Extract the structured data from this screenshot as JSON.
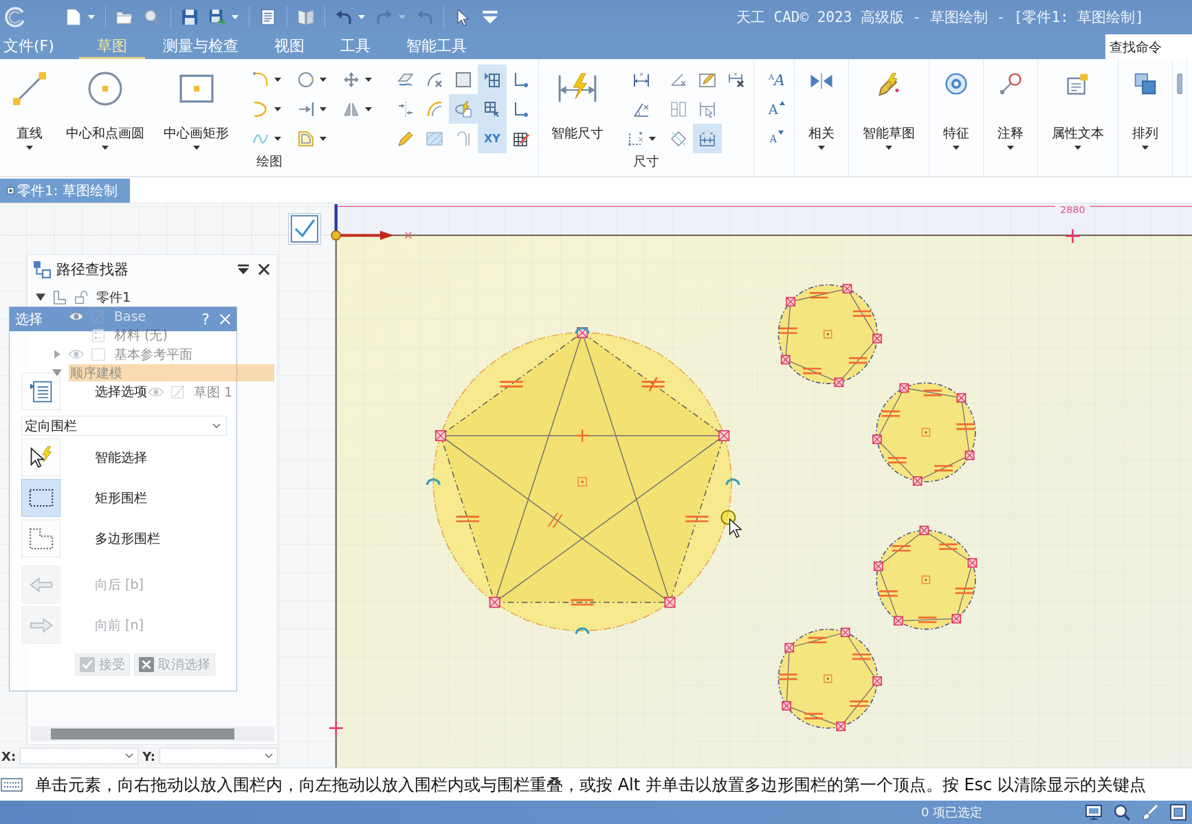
{
  "title_bar": {
    "quick_access": [
      [
        {
          "kind": "new",
          "dropdown": true,
          "disabled": false
        }
      ],
      [
        {
          "kind": "open",
          "dropdown": false,
          "disabled": false
        },
        {
          "kind": "find",
          "dropdown": false,
          "disabled": false
        }
      ],
      [
        {
          "kind": "save",
          "dropdown": false,
          "disabled": false
        },
        {
          "kind": "saveas",
          "dropdown": true,
          "disabled": false
        }
      ],
      [
        {
          "kind": "properties",
          "dropdown": false,
          "disabled": false
        }
      ],
      [
        {
          "kind": "book",
          "dropdown": false,
          "disabled": false
        }
      ],
      [
        {
          "kind": "undo",
          "dropdown": true,
          "disabled": false
        },
        {
          "kind": "redo",
          "dropdown": true,
          "disabled": true
        },
        {
          "kind": "revert",
          "dropdown": false,
          "disabled": true
        }
      ],
      [
        {
          "kind": "pointer",
          "dropdown": false,
          "disabled": false
        },
        {
          "kind": "customize",
          "dropdown": false,
          "disabled": false
        }
      ]
    ],
    "title": "天工 CAD© 2023 高级版 - 草图绘制 - [零件1: 草图绘制]"
  },
  "menu": {
    "tabs": [
      {
        "label": "文件(F)",
        "selected": false
      },
      {
        "label": "草图",
        "selected": true
      },
      {
        "label": "测量与检查",
        "selected": false
      },
      {
        "label": "视图",
        "selected": false
      },
      {
        "label": "工具",
        "selected": false
      },
      {
        "label": "智能工具",
        "selected": false
      }
    ],
    "search": {
      "placeholder": "查找命令"
    }
  },
  "ribbon": [
    {
      "label": "绘图",
      "buttons": [
        {
          "label": "直线",
          "kind": "line",
          "dropdown": true
        },
        {
          "label": "中心和点画圆",
          "kind": "circle",
          "dropdown": true
        },
        {
          "label": "中心画矩形",
          "kind": "rectangle",
          "dropdown": true
        }
      ],
      "tool_grids": [
        [
          [
            {
              "kind": "fillet",
              "on": false,
              "dropdown": true
            },
            {
              "kind": "arc",
              "on": false,
              "dropdown": true
            },
            {
              "kind": "curve",
              "on": false,
              "dropdown": true
            }
          ],
          [
            {
              "kind": "circle",
              "on": false,
              "dropdown": true
            },
            {
              "kind": "extend",
              "on": false,
              "dropdown": true
            },
            {
              "kind": "offset",
              "on": false,
              "dropdown": true
            }
          ],
          [
            {
              "kind": "move",
              "on": false,
              "dropdown": true
            },
            {
              "kind": "mirror",
              "on": false,
              "dropdown": true
            }
          ]
        ],
        [
          [
            {
              "kind": "project",
              "on": false,
              "dropdown": false
            },
            {
              "kind": "trim",
              "on": false,
              "dropdown": false
            },
            {
              "kind": "pencil",
              "on": false,
              "dropdown": false
            }
          ],
          [
            {
              "kind": "intersect",
              "on": false,
              "dropdown": false
            },
            {
              "kind": "blend",
              "on": false,
              "dropdown": false
            },
            {
              "kind": "hatch",
              "on": false,
              "dropdown": false
            }
          ],
          [
            {
              "kind": "square",
              "on": false,
              "dropdown": false
            },
            {
              "kind": "smart",
              "on": true,
              "dropdown": false
            },
            {
              "kind": "hook",
              "on": false,
              "dropdown": false
            }
          ],
          [
            {
              "kind": "grid",
              "on": true,
              "dropdown": false
            },
            {
              "kind": "snap",
              "on": true,
              "dropdown": false
            },
            {
              "kind": "xy",
              "label": "XY",
              "on": true,
              "dropdown": false
            }
          ],
          [
            {
              "kind": "corner",
              "on": false,
              "dropdown": false
            },
            {
              "kind": "corner",
              "on": false,
              "dropdown": false
            },
            {
              "kind": "gridedit",
              "on": false,
              "dropdown": false
            }
          ]
        ]
      ]
    },
    {
      "label": "尺寸",
      "buttons": [
        {
          "label": "智能尺寸",
          "kind": "smartdim",
          "dropdown": false
        }
      ],
      "tool_grids": [
        [
          [
            {
              "kind": "distance",
              "on": false,
              "dropdown": false
            },
            {
              "kind": "angle",
              "on": false,
              "dropdown": false
            },
            {
              "kind": "coordinate",
              "on": false,
              "dropdown": true
            }
          ],
          [
            {
              "kind": "between",
              "on": false,
              "dropdown": false
            },
            {
              "kind": "symmetric",
              "on": false,
              "dropdown": false
            },
            {
              "kind": "rotated",
              "on": false,
              "dropdown": false
            }
          ],
          [
            {
              "kind": "edit",
              "on": false,
              "dropdown": false
            },
            {
              "kind": "pointer",
              "on": false,
              "dropdown": false
            },
            {
              "kind": "group",
              "on": true,
              "dropdown": false
            }
          ],
          [
            {
              "kind": "delete",
              "on": false,
              "dropdown": false
            }
          ]
        ]
      ]
    },
    {
      "tool_grids": [
        [
          [
            {
              "kind": "style",
              "label": "$^{A}$A",
              "on": false,
              "dropdown": false
            },
            {
              "kind": "grow",
              "label": "A",
              "on": false,
              "dropdown": false
            },
            {
              "kind": "shrink",
              "label": "A",
              "on": false,
              "dropdown": false
            }
          ]
        ]
      ]
    },
    {
      "buttons": [
        {
          "label": "相关",
          "kind": "relate",
          "dropdown": true
        }
      ]
    },
    {
      "buttons": [
        {
          "label": "智能草图",
          "kind": "smartsketch",
          "dropdown": true
        }
      ]
    },
    {
      "buttons": [
        {
          "label": "特征",
          "kind": "feature",
          "dropdown": true
        }
      ]
    },
    {
      "buttons": [
        {
          "label": "注释",
          "kind": "annotation",
          "dropdown": true
        }
      ]
    },
    {
      "buttons": [
        {
          "label": "属性文本",
          "kind": "proptext",
          "dropdown": true
        }
      ]
    },
    {
      "buttons": [
        {
          "label": "排列",
          "kind": "arrange",
          "dropdown": true
        }
      ]
    },
    {
      "buttons": [
        {
          "kind": "cutoff",
          "dropdown": false
        }
      ]
    }
  ],
  "document_tabs": [
    {
      "label": "零件1: 草图绘制",
      "selected": true
    }
  ],
  "pathfinder": {
    "title": "路径查找器",
    "tree": [
      {
        "label": "零件1",
        "kind": "part",
        "expanded": true,
        "selected": false,
        "visible": false,
        "children": [
          {
            "label": "Base",
            "kind": "feature",
            "selected": false,
            "visible": true
          },
          {
            "label": "材料 (无)",
            "kind": "material",
            "selected": false,
            "visible": false
          },
          {
            "label": "基本参考平面",
            "kind": "plane",
            "expanded": false,
            "selected": false,
            "visible": true
          },
          {
            "label": "顺序建模",
            "kind": "group",
            "expanded": true,
            "selected": true,
            "visible": false,
            "children": [
              {
                "label": "草图 1",
                "kind": "sketch",
                "selected": false,
                "visible": true
              }
            ]
          }
        ]
      }
    ]
  },
  "select_dialog": {
    "title": "选择",
    "help": "?",
    "options": "选择选项",
    "fence": {
      "value": "定向围栏"
    },
    "modes": [
      {
        "label": "智能选择",
        "kind": "smart",
        "selected": false
      },
      {
        "label": "矩形围栏",
        "kind": "rectangle",
        "selected": true
      },
      {
        "label": "多边形围栏",
        "kind": "polygon",
        "selected": false
      }
    ],
    "history": [
      {
        "label": "向后 [b]",
        "kind": "back",
        "disabled": true
      },
      {
        "label": "向前 [n]",
        "kind": "forward",
        "disabled": true
      }
    ],
    "buttons": [
      {
        "label": "接受",
        "kind": "accept",
        "disabled": true
      },
      {
        "label": "取消选择",
        "kind": "clear",
        "disabled": true
      }
    ]
  },
  "coordinates": [
    {
      "label": "X:"
    },
    {
      "label": "Y:"
    }
  ],
  "canvas": {
    "dimension": "2880",
    "shapes": [
      {
        "kind": "star"
      },
      {
        "kind": "pentagon"
      },
      {
        "kind": "pentagon"
      },
      {
        "kind": "pentagon"
      },
      {
        "kind": "pentagon"
      }
    ]
  },
  "prompt": "单击元素，向右拖动以放入围栏内，向左拖动以放入围栏内或与围栏重叠，或按 Alt 并单击以放置多边形围栏的第一个顶点。按 Esc 以清除显示的关键点",
  "status_bar": {
    "selection": "0 项已选定"
  }
}
